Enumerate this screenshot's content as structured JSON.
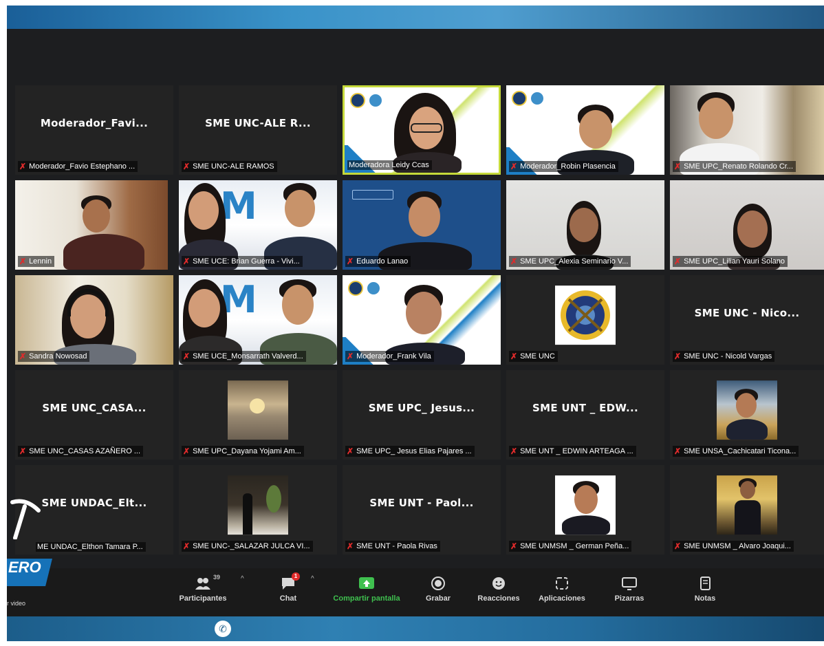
{
  "meeting": {
    "tiles": [
      {
        "big_name": "Moderador_Favi...",
        "label": "Moderador_Favio Estephano ...",
        "type": "name"
      },
      {
        "big_name": "SME UNC-ALE R...",
        "label": "SME UNC-ALE RAMOS",
        "type": "name"
      },
      {
        "label": "Moderadora Leidy Ccas",
        "type": "video",
        "active": true
      },
      {
        "label": "Moderador_Robin Plasencia",
        "type": "video"
      },
      {
        "label": "SME UPC_Renato Rolando Cr...",
        "type": "video"
      },
      {
        "label": "Lennin",
        "type": "video"
      },
      {
        "label": "SME UCE: Brian Guerra - Vivi...",
        "type": "video"
      },
      {
        "label": "Eduardo Lanao",
        "type": "video"
      },
      {
        "label": "SME UPC_Alexia Seminario V...",
        "type": "video"
      },
      {
        "label": "SME UPC_Lilian Yauri Solano",
        "type": "video"
      },
      {
        "label": "Sandra Nowosad",
        "type": "video"
      },
      {
        "label": "SME UCE_Monsarrath Valverd...",
        "type": "video"
      },
      {
        "label": "Moderador_Frank Vila",
        "type": "video"
      },
      {
        "label": "SME UNC",
        "type": "picture"
      },
      {
        "big_name": "SME UNC - Nico...",
        "label": "SME UNC - Nicold Vargas",
        "type": "name"
      },
      {
        "big_name": "SME UNC_CASA...",
        "label": "SME UNC_CASAS AZAÑERO ...",
        "type": "name"
      },
      {
        "label": "SME UPC_Dayana Yojami Am...",
        "type": "picture"
      },
      {
        "big_name": "SME UPC_ Jesus...",
        "label": "SME UPC_ Jesus Elias Pajares ...",
        "type": "name"
      },
      {
        "big_name": "SME UNT _ EDW...",
        "label": "SME UNT _ EDWIN ARTEAGA ...",
        "type": "name"
      },
      {
        "label": "SME UNSA_Cachicatari Ticona...",
        "type": "picture"
      },
      {
        "big_name": "SME UNDAC_Elt...",
        "label": "ME UNDAC_Elthon Tamara P...",
        "type": "name"
      },
      {
        "label": "SME UNC-_SALAZAR JULCA VI...",
        "type": "picture"
      },
      {
        "big_name": "SME UNT - Paol...",
        "label": "SME UNT - Paola Rivas",
        "type": "name"
      },
      {
        "label": "SME UNMSM _ German Peña...",
        "type": "picture"
      },
      {
        "label": "SME UNMSM _ Alvaro Joaqui...",
        "type": "picture"
      }
    ]
  },
  "toolbar": {
    "participants_label": "Participantes",
    "participants_count": "39",
    "chat_label": "Chat",
    "chat_badge": "1",
    "share_label": "Compartir pantalla",
    "record_label": "Grabar",
    "reactions_label": "Reacciones",
    "apps_label": "Aplicaciones",
    "whiteboard_label": "Pizarras",
    "notes_label": "Notas"
  },
  "overlay": {
    "banner_text": "ERO",
    "video_text": "r video"
  },
  "colors": {
    "active_border": "#c5d93a",
    "share_green": "#3fc04f",
    "mic_red": "#e02b2b",
    "toolbar_bg": "#1a1a1a"
  }
}
